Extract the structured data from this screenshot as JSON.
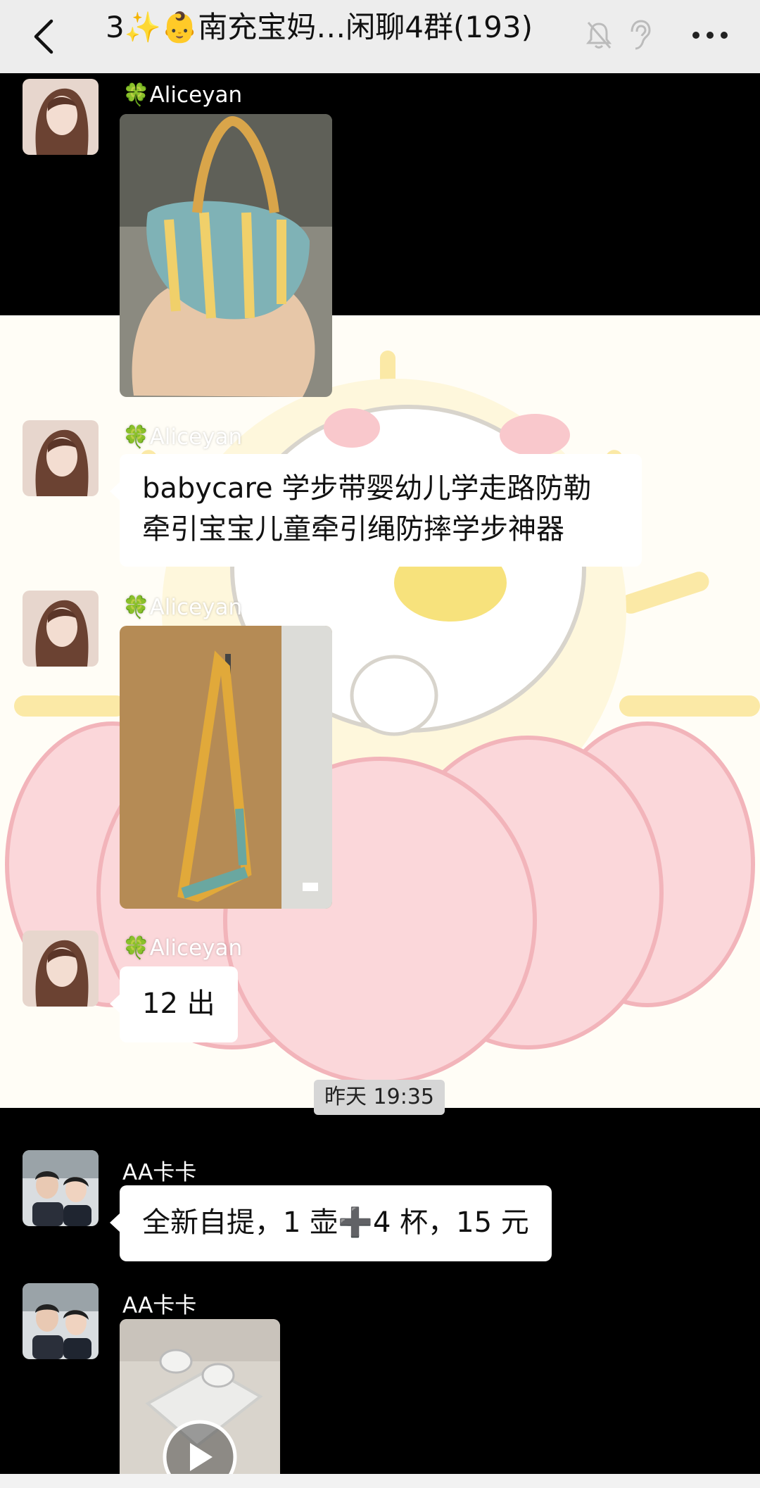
{
  "header": {
    "title": "3✨👶南充宝妈…闲聊4群(193)",
    "icons": [
      "back-arrow-icon",
      "mute-bell-icon",
      "ear-icon",
      "more-icon"
    ]
  },
  "messages": [
    {
      "sender": "🍀Aliceyan",
      "type": "image",
      "image_desc": "striped walker harness"
    },
    {
      "sender": "🍀Aliceyan",
      "type": "text",
      "line1": "babycare 学步带婴幼儿学走路防勒",
      "line2": "牵引宝宝儿童牵引绳防摔学步神器"
    },
    {
      "sender": "🍀Aliceyan",
      "type": "image",
      "image_desc": "hanging harness strap"
    },
    {
      "sender": "🍀Aliceyan",
      "type": "text",
      "text": "12 出"
    },
    {
      "sender": "AA卡卡",
      "type": "text",
      "text": "全新自提，1 壶➕4 杯，15 元"
    },
    {
      "sender": "AA卡卡",
      "type": "video",
      "image_desc": "glass pot and cups"
    }
  ],
  "timestamp": "昨天 19:35",
  "colors": {
    "header_bg": "#ededed",
    "chat_bg_dark": "#000000",
    "bubble": "#ffffff",
    "timestamp_bg": "#d6d6d6"
  }
}
